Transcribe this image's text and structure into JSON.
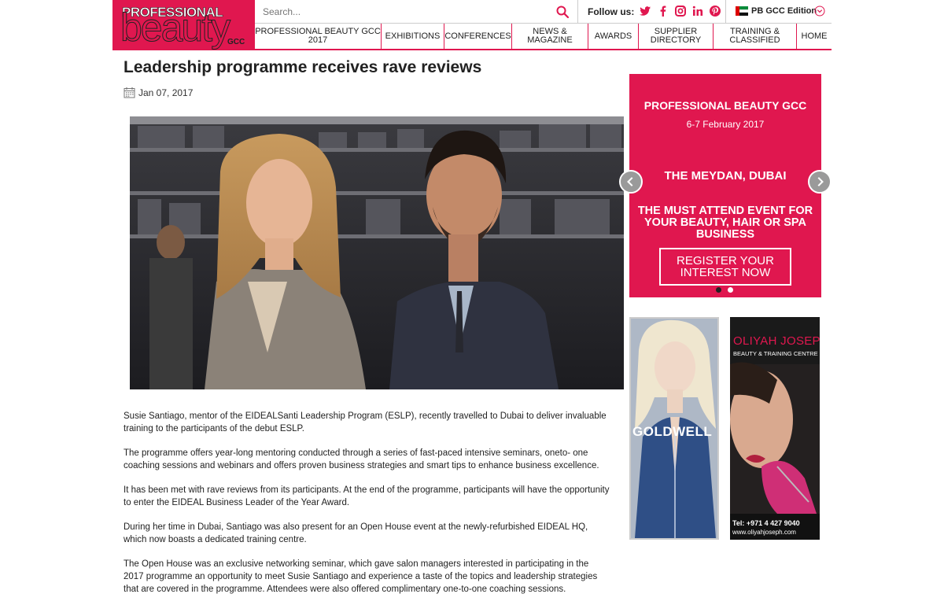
{
  "logo": {
    "line1": "PROFESSIONAL",
    "line2": "beauty",
    "line3": "GCC"
  },
  "search": {
    "placeholder": "Search..."
  },
  "follow": {
    "label": "Follow us:",
    "icons": [
      "twitter-icon",
      "facebook-icon",
      "instagram-icon",
      "linkedin-icon",
      "pinterest-icon"
    ]
  },
  "edition": {
    "label": "PB GCC Edition"
  },
  "nav": {
    "items": [
      {
        "label": "PROFESSIONAL BEAUTY GCC 2017"
      },
      {
        "label": "EXHIBITIONS"
      },
      {
        "label": "CONFERENCES"
      },
      {
        "label": "NEWS & MAGAZINE"
      },
      {
        "label": "AWARDS"
      },
      {
        "label": "SUPPLIER DIRECTORY"
      },
      {
        "label": "TRAINING & CLASSIFIED"
      },
      {
        "label": "HOME"
      }
    ]
  },
  "article": {
    "title": "Leadership programme receives rave reviews",
    "date": "Jan 07, 2017",
    "paragraphs": [
      "Susie Santiago, mentor of the EIDEALSanti Leadership Program (ESLP), recently travelled to Dubai to deliver invaluable training to the participants of the debut ESLP.",
      "The programme offers year-long mentoring conducted through a series of fast-paced intensive seminars, oneto- one coaching sessions and webinars and offers proven business strategies and smart tips to enhance business excellence.",
      "It has been met with rave reviews from its participants. At the end of the programme, participants will have the opportunity to enter the EIDEAL Business Leader of the Year Award.",
      "During her time in Dubai, Santiago was also present for an Open House event at the newly-refurbished EIDEAL HQ, which now boasts a dedicated training centre.",
      "The Open House was an exclusive networking seminar, which gave salon managers interested in participating in the 2017 programme an opportunity to meet Susie Santiago and experience a taste of the topics and leadership strategies that are covered in the programme. Attendees were also offered complimentary one-to-one coaching sessions."
    ]
  },
  "banner": {
    "title": "PROFESSIONAL BEAUTY GCC",
    "dates": "6-7 February 2017",
    "venue": "THE MEYDAN, DUBAI",
    "tagline": "THE MUST ATTEND EVENT FOR YOUR BEAUTY, HAIR OR SPA BUSINESS",
    "button": "REGISTER YOUR INTEREST NOW",
    "active_slide": 1,
    "slide_count": 2
  },
  "ads": {
    "goldwell": "GOLDWELL",
    "oliyah": {
      "name": "OLIYAH JOSEPH",
      "subtitle": "BEAUTY & TRAINING CENTRE",
      "tel": "Tel: +971 4 427 9040",
      "web": "www.oliyahjoseph.com"
    }
  },
  "colors": {
    "brand": "#e0174f",
    "text": "#222222"
  }
}
